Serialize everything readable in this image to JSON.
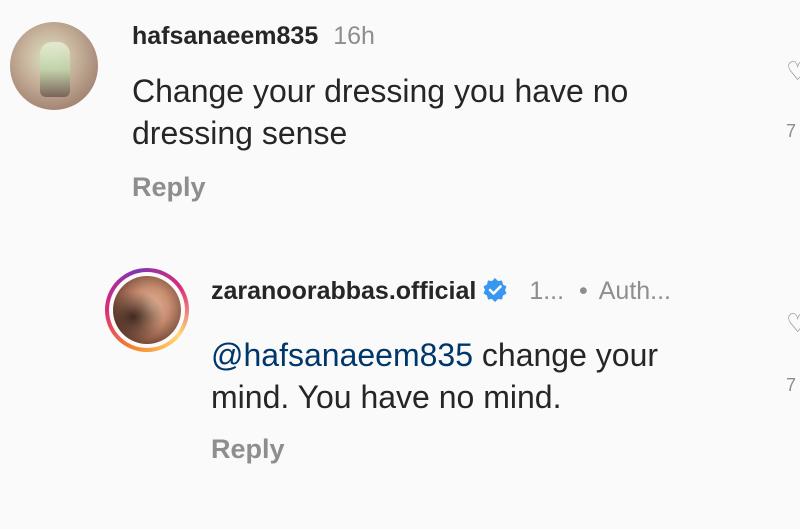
{
  "comment": {
    "username": "hafsanaeem835",
    "time": "16h",
    "text_line1": "Change your dressing you have no",
    "text_line2": "dressing sense",
    "reply_label": "Reply"
  },
  "reply": {
    "username": "zaranoorabbas.official",
    "time": "1...",
    "separator": "•",
    "badge": "Auth...",
    "mention": "@hafsanaeem835",
    "text_line1_rest": " change your",
    "text_line2": "mind. You have no mind.",
    "reply_label": "Reply"
  },
  "colors": {
    "background": "#fafafa",
    "text": "#262626",
    "muted": "#8e8e8e",
    "mention": "#00376b",
    "verified": "#3897f0"
  },
  "icons": {
    "verified": "verified-badge-icon",
    "like": "heart-icon"
  }
}
